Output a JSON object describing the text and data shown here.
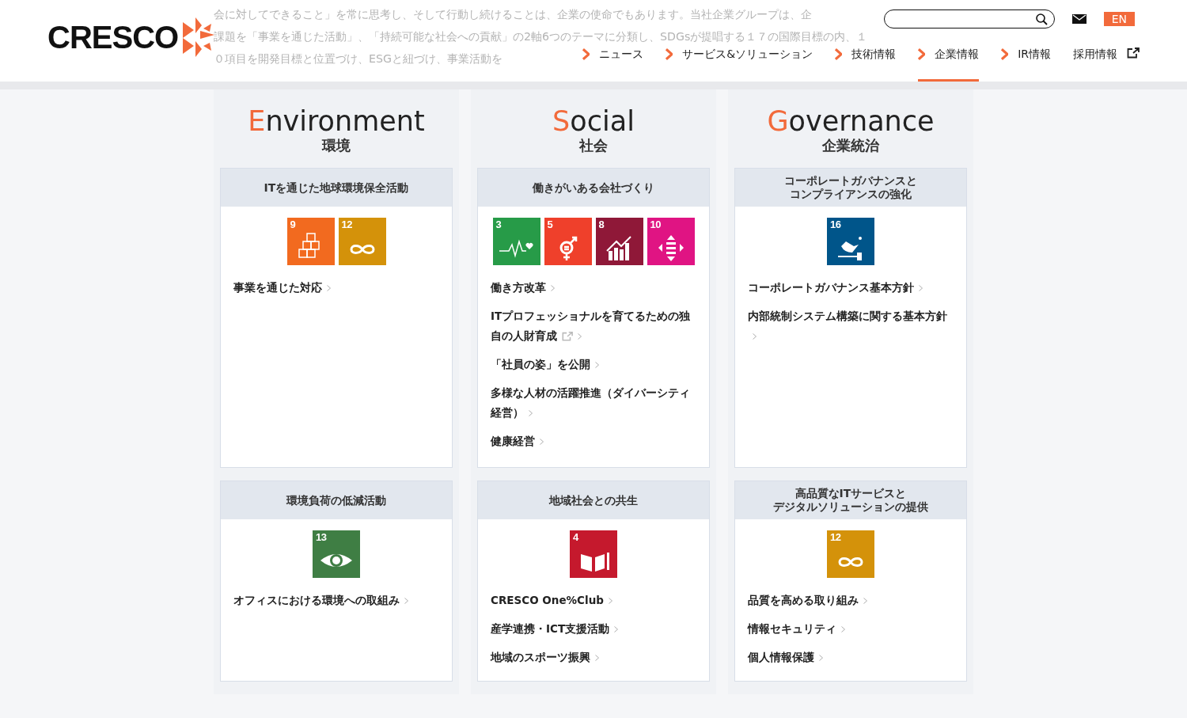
{
  "header": {
    "logo": "CRESCO",
    "background_text": [
      "会に対してできること」を常に思考し、そして行動し続けることは、企業の使命でもあります。当社企業グループは、企",
      "課題を「事業を通じた活動」、「持続可能な社会への貢献」の2軸6つのテーマに分類し、SDGsが提唱する１７の国際目標の内、１",
      "０項目を開発目標と位置づけ、ESGと紐づけ、事業活動を"
    ],
    "language": "EN",
    "nav": [
      {
        "label": "ニュース",
        "kind": "section",
        "selected": false
      },
      {
        "label": "サービス&ソリューション",
        "kind": "section",
        "selected": false
      },
      {
        "label": "技術情報",
        "kind": "section",
        "selected": false
      },
      {
        "label": "企業情報",
        "kind": "section",
        "selected": true
      },
      {
        "label": "IR情報",
        "kind": "section",
        "selected": false
      },
      {
        "label": "採用情報",
        "kind": "external",
        "selected": false
      }
    ]
  },
  "pillars": [
    {
      "initial": "E",
      "rest": "nvironment",
      "japanese": "環境",
      "cards": [
        {
          "title": [
            "ITを通じた地球環境保全活動"
          ],
          "goals": [
            {
              "number": "9",
              "kind": "industry",
              "color": "#f26a1f"
            },
            {
              "number": "12",
              "kind": "consumption",
              "color": "#d4920a"
            }
          ],
          "links": [
            {
              "label": "事業を通じた対応",
              "external": false
            }
          ]
        },
        {
          "title": [
            "環境負荷の低減活動"
          ],
          "goals": [
            {
              "number": "13",
              "kind": "climate",
              "color": "#3f7e44"
            }
          ],
          "links": [
            {
              "label": "オフィスにおける環境への取組み",
              "external": false
            }
          ]
        }
      ]
    },
    {
      "initial": "S",
      "rest": "ocial",
      "japanese": "社会",
      "cards": [
        {
          "title": [
            "働きがいある会社づくり"
          ],
          "goals": [
            {
              "number": "3",
              "kind": "health",
              "color": "#279b48"
            },
            {
              "number": "5",
              "kind": "gender",
              "color": "#ef402b"
            },
            {
              "number": "8",
              "kind": "growth",
              "color": "#8f1838"
            },
            {
              "number": "10",
              "kind": "inequality",
              "color": "#e01483"
            }
          ],
          "links": [
            {
              "label": "働き方改革",
              "external": false
            },
            {
              "label": "ITプロフェッショナルを育てるための独自の人財育成",
              "external": true
            },
            {
              "label": "「社員の姿」を公開",
              "external": false
            },
            {
              "label": "多様な人材の活躍推進（ダイバーシティ経営）",
              "external": false
            },
            {
              "label": "健康経営",
              "external": false
            }
          ]
        },
        {
          "title": [
            "地域社会との共生"
          ],
          "goals": [
            {
              "number": "4",
              "kind": "education",
              "color": "#c5192d"
            }
          ],
          "links": [
            {
              "label": "CRESCO One%Club",
              "external": false
            },
            {
              "label": "産学連携・ICT支援活動",
              "external": false
            },
            {
              "label": "地域のスポーツ振興",
              "external": false
            }
          ]
        }
      ]
    },
    {
      "initial": "G",
      "rest": "overnance",
      "japanese": "企業統治",
      "cards": [
        {
          "title": [
            "コーポレートガバナンスと",
            "コンプライアンスの強化"
          ],
          "goals": [
            {
              "number": "16",
              "kind": "peace",
              "color": "#00558a"
            }
          ],
          "links": [
            {
              "label": "コーポレートガバナンス基本方針",
              "external": false
            },
            {
              "label": "内部統制システム構築に関する基本方針",
              "external": false
            }
          ]
        },
        {
          "title": [
            "高品質なITサービスと",
            "デジタルソリューションの提供"
          ],
          "goals": [
            {
              "number": "12",
              "kind": "consumption",
              "color": "#d4920a"
            }
          ],
          "links": [
            {
              "label": "品質を高める取り組み",
              "external": false
            },
            {
              "label": "情報セキュリティ",
              "external": false
            },
            {
              "label": "個人情報保護",
              "external": false
            }
          ]
        }
      ]
    }
  ]
}
